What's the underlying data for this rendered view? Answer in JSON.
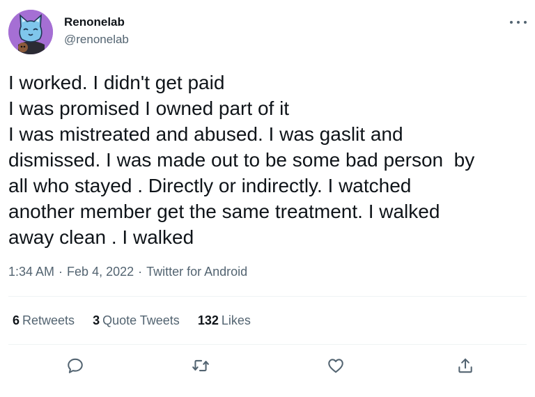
{
  "user": {
    "display_name": "Renonelab",
    "handle": "@renonelab",
    "avatar_icon": "cat-avatar-icon"
  },
  "tweet": {
    "text": "I worked. I didn't get paid\nI was promised I owned part of it\nI was mistreated and abused. I was gaslit and\ndismissed. I was made out to be some bad person  by\nall who stayed . Directly or indirectly. I watched\nanother member get the same treatment. I walked\naway clean . I walked",
    "time": "1:34 AM",
    "date": "Feb 4, 2022",
    "source": "Twitter for Android",
    "separator": "·"
  },
  "stats": {
    "retweets_count": "6",
    "retweets_label": "Retweets",
    "quotes_count": "3",
    "quotes_label": "Quote Tweets",
    "likes_count": "132",
    "likes_label": "Likes"
  },
  "actions": [
    "reply-icon",
    "retweet-icon",
    "like-icon",
    "share-icon"
  ],
  "colors": {
    "text": "#0f1419",
    "secondary": "#536471",
    "divider": "#eff3f4",
    "avatar_bg": "#a56fd4"
  }
}
